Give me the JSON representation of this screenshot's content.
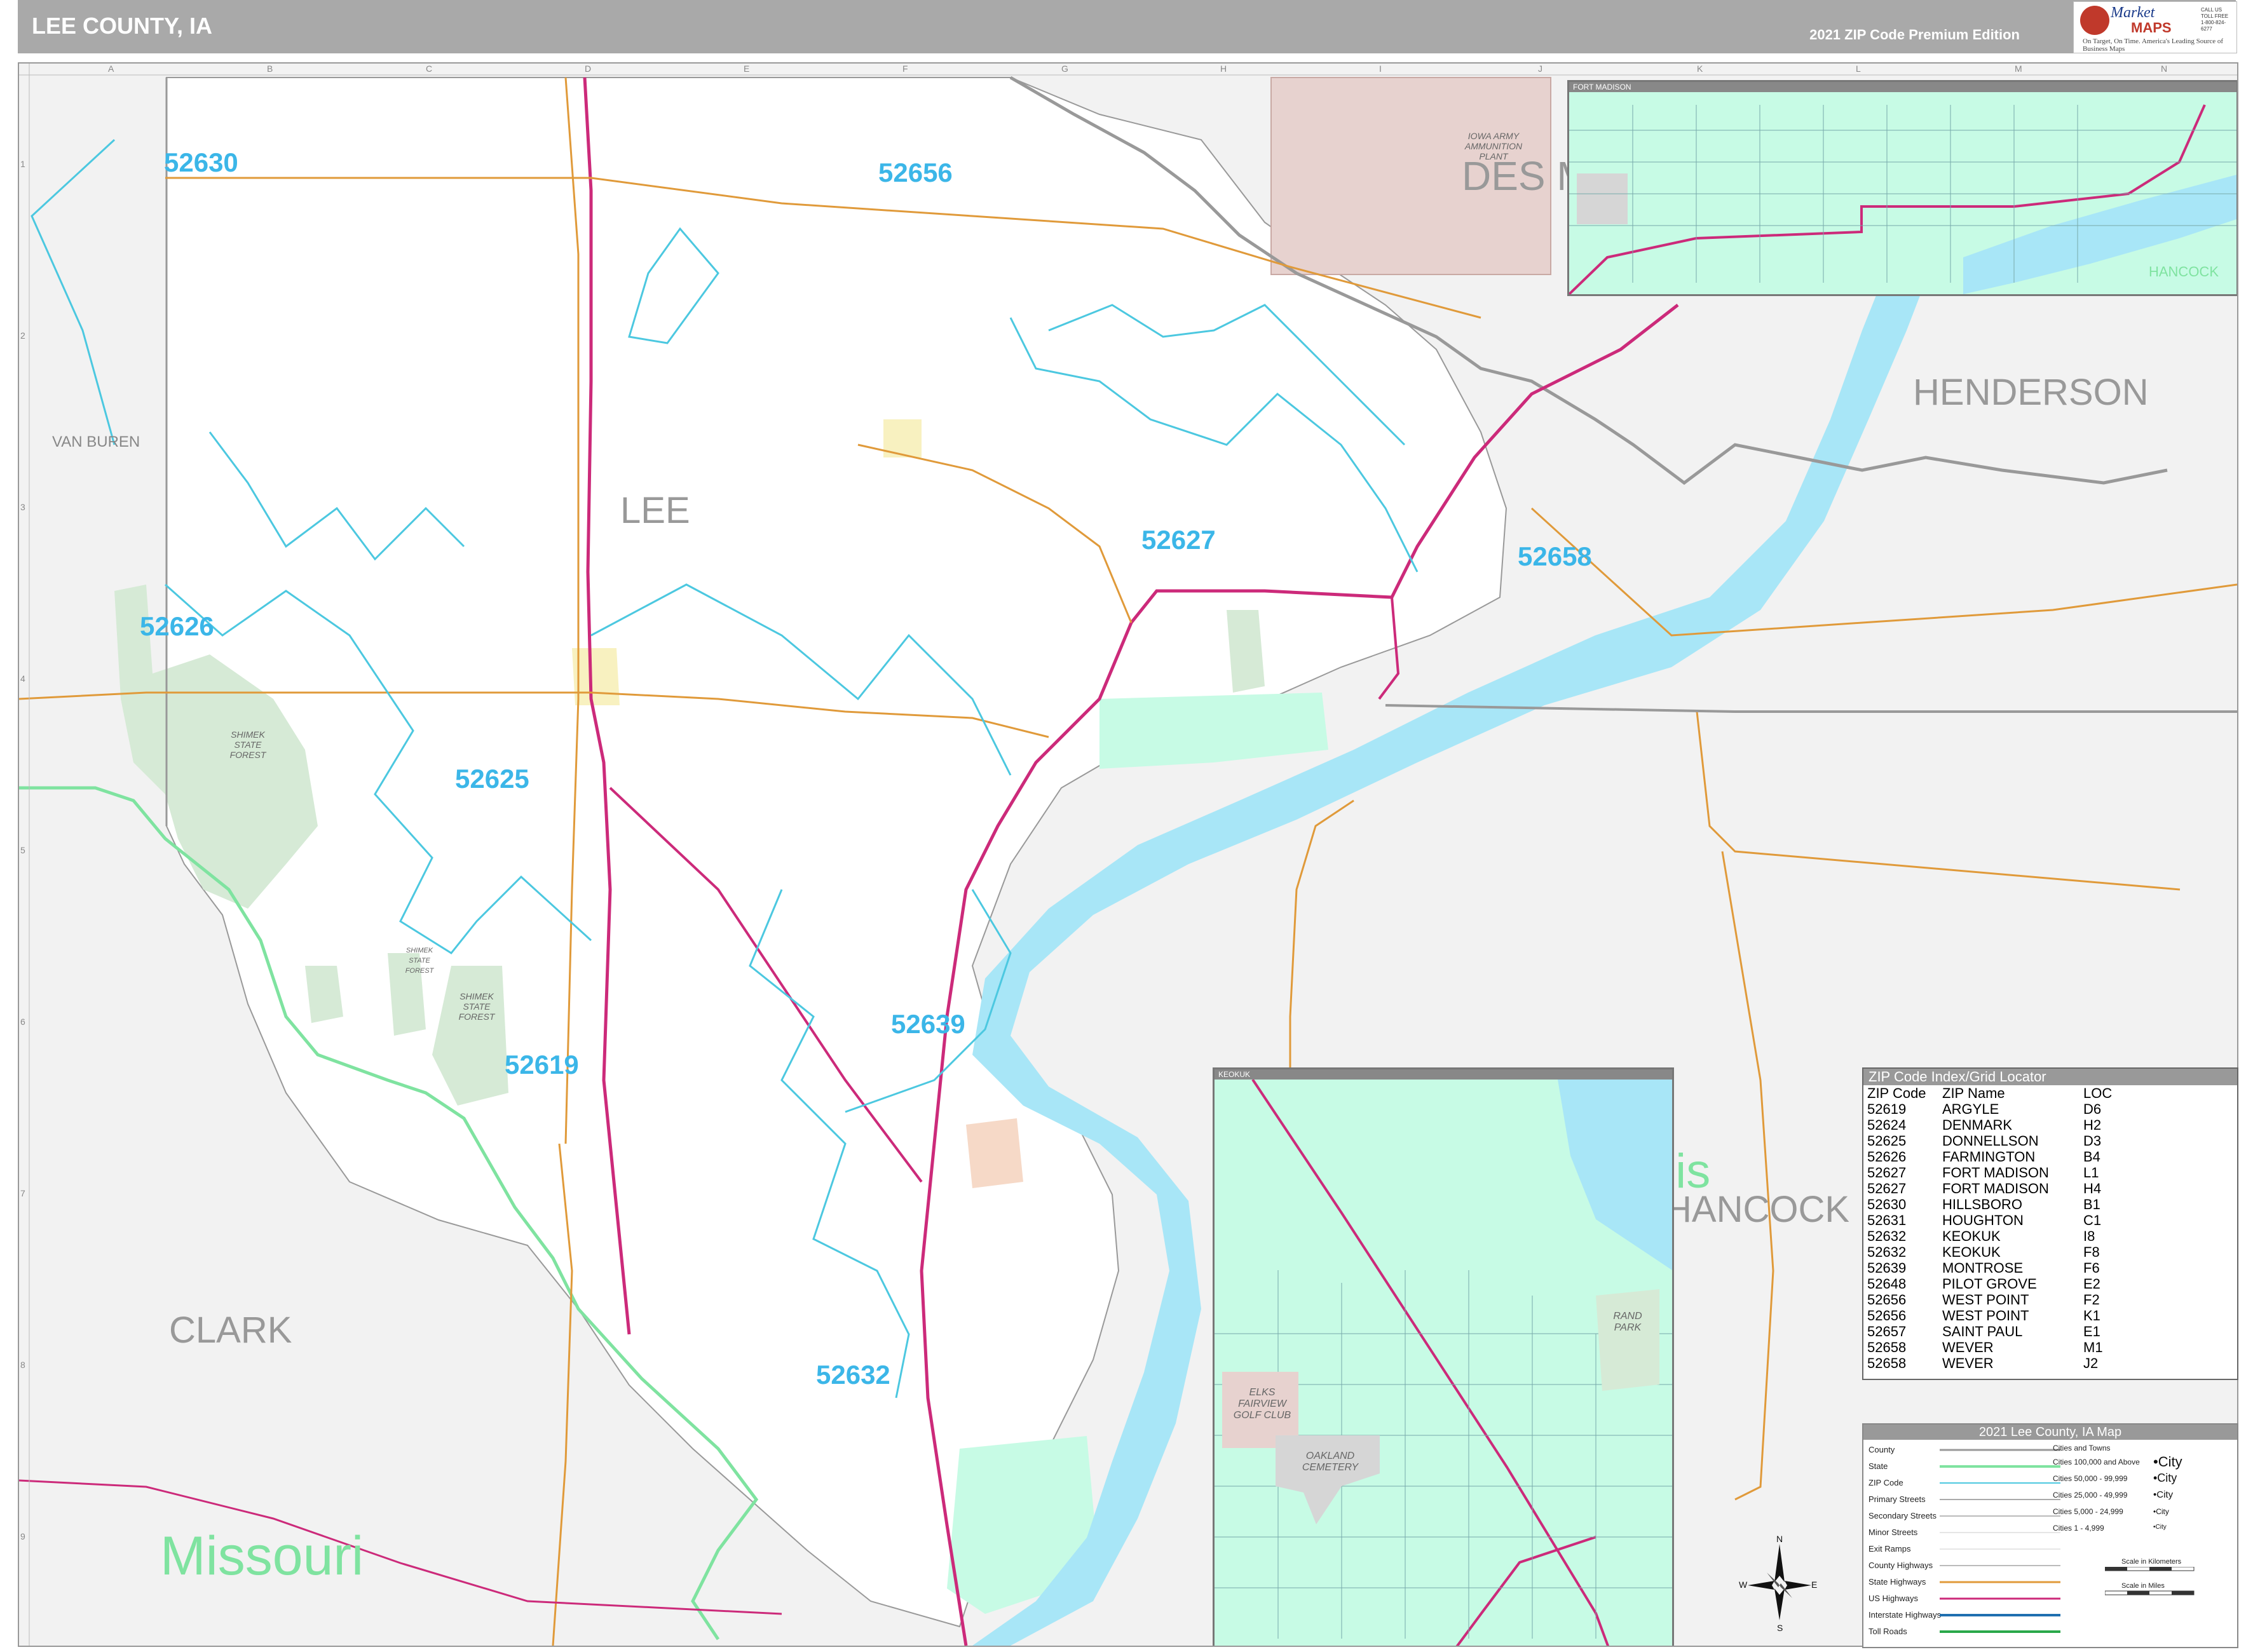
{
  "header": {
    "title": "LEE COUNTY, IA",
    "edition": "2021 ZIP Code Premium Edition"
  },
  "logo": {
    "brand_top": "Market",
    "brand_bottom": "MAPS",
    "tagline": "On Target, On Time. America's Leading Source of Business Maps",
    "phone": "CALL US TOLL FREE 1-800-824-6277"
  },
  "grid": {
    "columns": [
      "A",
      "B",
      "C",
      "D",
      "E",
      "F",
      "G",
      "H",
      "I",
      "J",
      "K",
      "L",
      "M",
      "N"
    ],
    "rows": [
      "1",
      "2",
      "3",
      "4",
      "5",
      "6",
      "7",
      "8",
      "9"
    ]
  },
  "labels": {
    "county_lee": "LEE",
    "county_des_moines": "DES M",
    "county_henderson": "HENDERSON",
    "county_van_buren": "VAN BUREN",
    "county_clark": "CLARK",
    "county_hancock": "HANCOCK",
    "state_missouri": "Missouri",
    "state_illinois": "Illinois",
    "ammo_plant": "IOWA ARMY AMMUNITION PLANT",
    "shimek_1": "SHIMEK STATE FOREST",
    "shimek_2": "SHIMEK STATE FOREST",
    "shimek_3": "SHIMEK STATE FOREST"
  },
  "zips": {
    "z52630": "52630",
    "z52656": "52656",
    "z52626": "52626",
    "z52625": "52625",
    "z52627": "52627",
    "z52658": "52658",
    "z52619": "52619",
    "z52639": "52639",
    "z52632": "52632"
  },
  "insets": {
    "fort_madison": "FORT MADISON",
    "keokuk": "KEOKUK",
    "ft_hancock": "HANCOCK",
    "elks": "ELKS FAIRVIEW GOLF CLUB",
    "oakland": "OAKLAND CEMETERY",
    "rand": "RAND PARK"
  },
  "zip_index": {
    "title": "ZIP Code Index/Grid Locator",
    "headers": [
      "ZIP Code",
      "ZIP Name",
      "LOC"
    ],
    "rows": [
      [
        "52619",
        "ARGYLE",
        "D6"
      ],
      [
        "52624",
        "DENMARK",
        "H2"
      ],
      [
        "52625",
        "DONNELLSON",
        "D3"
      ],
      [
        "52626",
        "FARMINGTON",
        "B4"
      ],
      [
        "52627",
        "FORT MADISON",
        "L1"
      ],
      [
        "52627",
        "FORT MADISON",
        "H4"
      ],
      [
        "52630",
        "HILLSBORO",
        "B1"
      ],
      [
        "52631",
        "HOUGHTON",
        "C1"
      ],
      [
        "52632",
        "KEOKUK",
        "I8"
      ],
      [
        "52632",
        "KEOKUK",
        "F8"
      ],
      [
        "52639",
        "MONTROSE",
        "F6"
      ],
      [
        "52648",
        "PILOT GROVE",
        "E2"
      ],
      [
        "52656",
        "WEST POINT",
        "F2"
      ],
      [
        "52656",
        "WEST POINT",
        "K1"
      ],
      [
        "52657",
        "SAINT PAUL",
        "E1"
      ],
      [
        "52658",
        "WEVER",
        "M1"
      ],
      [
        "52658",
        "WEVER",
        "J2"
      ]
    ]
  },
  "legend": {
    "title": "2021 Lee County, IA Map",
    "items": [
      "County",
      "State",
      "ZIP Code",
      "Primary Streets",
      "Secondary Streets",
      "Minor Streets",
      "Exit Ramps",
      "County Highways",
      "State Highways",
      "US Highways",
      "Interstate Highways",
      "Toll Roads"
    ],
    "cities_header": "Cities and Towns",
    "city_classes": [
      "Cities 100,000 and Above",
      "Cities 50,000 - 99,999",
      "Cities 25,000 - 49,999",
      "Cities 5,000 - 24,999",
      "Cities 1 - 4,999"
    ],
    "city_samples": [
      "•City",
      "•City",
      "•City",
      "•City",
      "•City"
    ],
    "scale_km": "Scale in Kilometers",
    "scale_mi": "Scale in Miles"
  },
  "compass": {
    "n": "N",
    "s": "S",
    "e": "E",
    "w": "W"
  },
  "colors": {
    "water": "#a8e6f7",
    "zip_line": "#4cc8e0",
    "us_highway": "#cc2a7a",
    "county_road": "#e09a3a",
    "state_line": "#7fe3a0",
    "urban": "#c7fbe5",
    "park": "#d6ead6",
    "military": "#e7d2cf"
  }
}
